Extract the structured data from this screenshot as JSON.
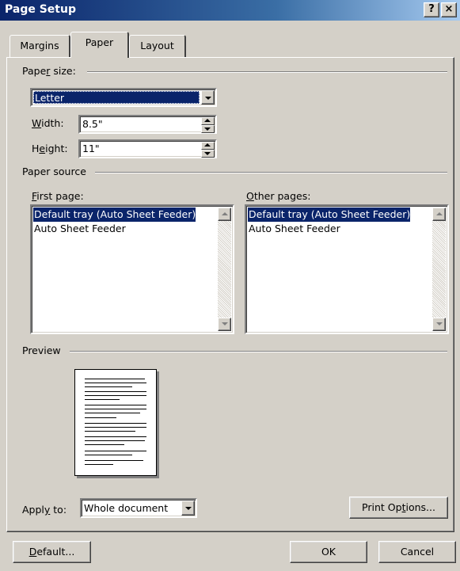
{
  "window": {
    "title": "Page Setup",
    "help_button": "?",
    "close_button": "×"
  },
  "tabs": [
    {
      "label": "Margins",
      "active": false
    },
    {
      "label": "Paper",
      "active": true
    },
    {
      "label": "Layout",
      "active": false
    }
  ],
  "paper_size": {
    "group_label_pre": "Pape",
    "group_label_ul": "r",
    "group_label_post": " size:",
    "selected": "Letter",
    "width_label_ul": "W",
    "width_label_rest": "idth:",
    "width_value": "8.5\"",
    "height_label_pre": "H",
    "height_label_ul": "e",
    "height_label_post": "ight:",
    "height_value": "11\""
  },
  "paper_source": {
    "group_label": "Paper source",
    "first_page": {
      "label_ul": "F",
      "label_rest": "irst page:",
      "items": [
        "Default tray (Auto Sheet Feeder)",
        "Auto Sheet Feeder"
      ],
      "selected_index": 0
    },
    "other_pages": {
      "label_ul": "O",
      "label_rest": "ther pages:",
      "items": [
        "Default tray (Auto Sheet Feeder)",
        "Auto Sheet Feeder"
      ],
      "selected_index": 0
    }
  },
  "preview": {
    "group_label": "Preview"
  },
  "apply_to": {
    "label_pre": "Appl",
    "label_ul": "y",
    "label_post": " to:",
    "value": "Whole document"
  },
  "buttons": {
    "print_options_pre": "Print Op",
    "print_options_ul": "t",
    "print_options_post": "ions...",
    "default_ul": "D",
    "default_rest": "efault...",
    "ok": "OK",
    "cancel": "Cancel"
  },
  "colors": {
    "face": "#d4d0c8",
    "selection": "#0a246a",
    "title_start": "#0a246a",
    "title_end": "#a6caf0"
  },
  "icons": {
    "dropdown": "chevron-down-icon",
    "spin_up": "chevron-up-icon",
    "spin_down": "chevron-down-icon"
  }
}
